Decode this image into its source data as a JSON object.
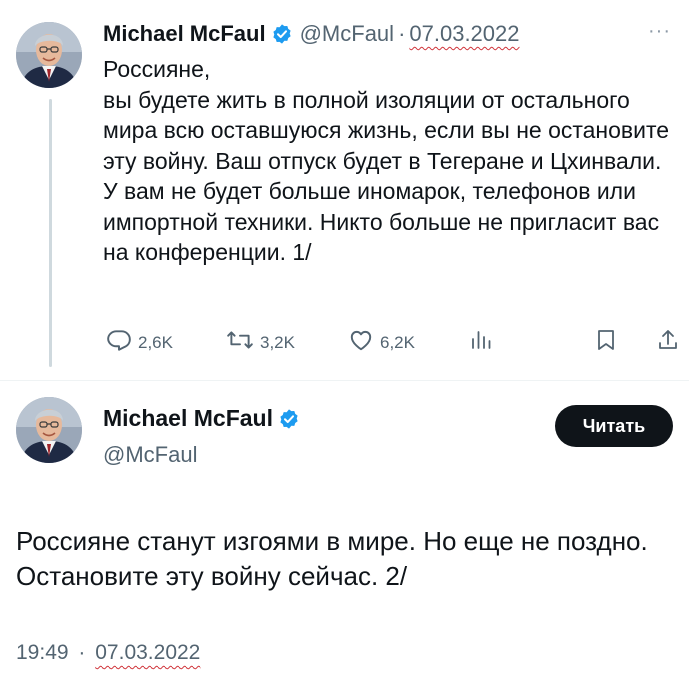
{
  "tweet1": {
    "author_name": "Michael McFaul",
    "handle": "@McFaul",
    "separator": "·",
    "date": "07.03.2022",
    "more_label": "···",
    "text": "Россияне,\nвы будете жить в полной изоляции от остального мира всю оставшуюся жизнь, если вы не остановите эту войну. Ваш отпуск будет в Тегеране и Цхинвали. У вам не будет больше иномарок, телефонов или импортной техники. Никто больше не пригласит вас на конференции. 1/",
    "replies": "2,6K",
    "retweets": "3,2K",
    "likes": "6,2K"
  },
  "tweet2": {
    "author_name": "Michael McFaul",
    "handle": "@McFaul",
    "read_button": "Читать",
    "text": "Россияне станут изгоями в мире. Но еще не поздно. Остановите эту войну сейчас. 2/",
    "time": "19:49",
    "separator": "·",
    "date": "07.03.2022"
  },
  "colors": {
    "verified_badge": "#1d9bf0",
    "secondary_text": "#536471",
    "spellcheck_underline": "#d0343a"
  },
  "icons": [
    "reply-icon",
    "retweet-icon",
    "like-icon",
    "views-icon",
    "bookmark-icon",
    "share-icon",
    "verified-badge-icon",
    "more-icon"
  ]
}
